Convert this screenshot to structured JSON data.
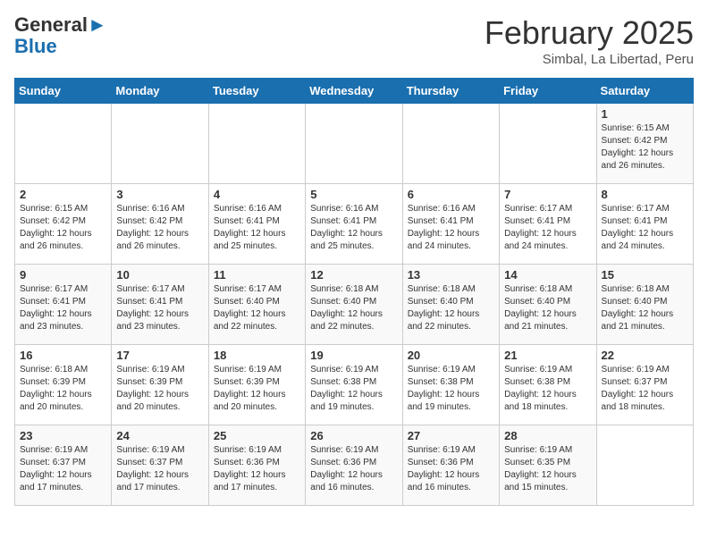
{
  "header": {
    "logo_general": "General",
    "logo_blue": "Blue",
    "title": "February 2025",
    "subtitle": "Simbal, La Libertad, Peru"
  },
  "days_of_week": [
    "Sunday",
    "Monday",
    "Tuesday",
    "Wednesday",
    "Thursday",
    "Friday",
    "Saturday"
  ],
  "weeks": [
    [
      {
        "day": "",
        "info": ""
      },
      {
        "day": "",
        "info": ""
      },
      {
        "day": "",
        "info": ""
      },
      {
        "day": "",
        "info": ""
      },
      {
        "day": "",
        "info": ""
      },
      {
        "day": "",
        "info": ""
      },
      {
        "day": "1",
        "info": "Sunrise: 6:15 AM\nSunset: 6:42 PM\nDaylight: 12 hours and 26 minutes."
      }
    ],
    [
      {
        "day": "2",
        "info": "Sunrise: 6:15 AM\nSunset: 6:42 PM\nDaylight: 12 hours and 26 minutes."
      },
      {
        "day": "3",
        "info": "Sunrise: 6:16 AM\nSunset: 6:42 PM\nDaylight: 12 hours and 26 minutes."
      },
      {
        "day": "4",
        "info": "Sunrise: 6:16 AM\nSunset: 6:41 PM\nDaylight: 12 hours and 25 minutes."
      },
      {
        "day": "5",
        "info": "Sunrise: 6:16 AM\nSunset: 6:41 PM\nDaylight: 12 hours and 25 minutes."
      },
      {
        "day": "6",
        "info": "Sunrise: 6:16 AM\nSunset: 6:41 PM\nDaylight: 12 hours and 24 minutes."
      },
      {
        "day": "7",
        "info": "Sunrise: 6:17 AM\nSunset: 6:41 PM\nDaylight: 12 hours and 24 minutes."
      },
      {
        "day": "8",
        "info": "Sunrise: 6:17 AM\nSunset: 6:41 PM\nDaylight: 12 hours and 24 minutes."
      }
    ],
    [
      {
        "day": "9",
        "info": "Sunrise: 6:17 AM\nSunset: 6:41 PM\nDaylight: 12 hours and 23 minutes."
      },
      {
        "day": "10",
        "info": "Sunrise: 6:17 AM\nSunset: 6:41 PM\nDaylight: 12 hours and 23 minutes."
      },
      {
        "day": "11",
        "info": "Sunrise: 6:17 AM\nSunset: 6:40 PM\nDaylight: 12 hours and 22 minutes."
      },
      {
        "day": "12",
        "info": "Sunrise: 6:18 AM\nSunset: 6:40 PM\nDaylight: 12 hours and 22 minutes."
      },
      {
        "day": "13",
        "info": "Sunrise: 6:18 AM\nSunset: 6:40 PM\nDaylight: 12 hours and 22 minutes."
      },
      {
        "day": "14",
        "info": "Sunrise: 6:18 AM\nSunset: 6:40 PM\nDaylight: 12 hours and 21 minutes."
      },
      {
        "day": "15",
        "info": "Sunrise: 6:18 AM\nSunset: 6:40 PM\nDaylight: 12 hours and 21 minutes."
      }
    ],
    [
      {
        "day": "16",
        "info": "Sunrise: 6:18 AM\nSunset: 6:39 PM\nDaylight: 12 hours and 20 minutes."
      },
      {
        "day": "17",
        "info": "Sunrise: 6:19 AM\nSunset: 6:39 PM\nDaylight: 12 hours and 20 minutes."
      },
      {
        "day": "18",
        "info": "Sunrise: 6:19 AM\nSunset: 6:39 PM\nDaylight: 12 hours and 20 minutes."
      },
      {
        "day": "19",
        "info": "Sunrise: 6:19 AM\nSunset: 6:38 PM\nDaylight: 12 hours and 19 minutes."
      },
      {
        "day": "20",
        "info": "Sunrise: 6:19 AM\nSunset: 6:38 PM\nDaylight: 12 hours and 19 minutes."
      },
      {
        "day": "21",
        "info": "Sunrise: 6:19 AM\nSunset: 6:38 PM\nDaylight: 12 hours and 18 minutes."
      },
      {
        "day": "22",
        "info": "Sunrise: 6:19 AM\nSunset: 6:37 PM\nDaylight: 12 hours and 18 minutes."
      }
    ],
    [
      {
        "day": "23",
        "info": "Sunrise: 6:19 AM\nSunset: 6:37 PM\nDaylight: 12 hours and 17 minutes."
      },
      {
        "day": "24",
        "info": "Sunrise: 6:19 AM\nSunset: 6:37 PM\nDaylight: 12 hours and 17 minutes."
      },
      {
        "day": "25",
        "info": "Sunrise: 6:19 AM\nSunset: 6:36 PM\nDaylight: 12 hours and 17 minutes."
      },
      {
        "day": "26",
        "info": "Sunrise: 6:19 AM\nSunset: 6:36 PM\nDaylight: 12 hours and 16 minutes."
      },
      {
        "day": "27",
        "info": "Sunrise: 6:19 AM\nSunset: 6:36 PM\nDaylight: 12 hours and 16 minutes."
      },
      {
        "day": "28",
        "info": "Sunrise: 6:19 AM\nSunset: 6:35 PM\nDaylight: 12 hours and 15 minutes."
      },
      {
        "day": "",
        "info": ""
      }
    ]
  ]
}
